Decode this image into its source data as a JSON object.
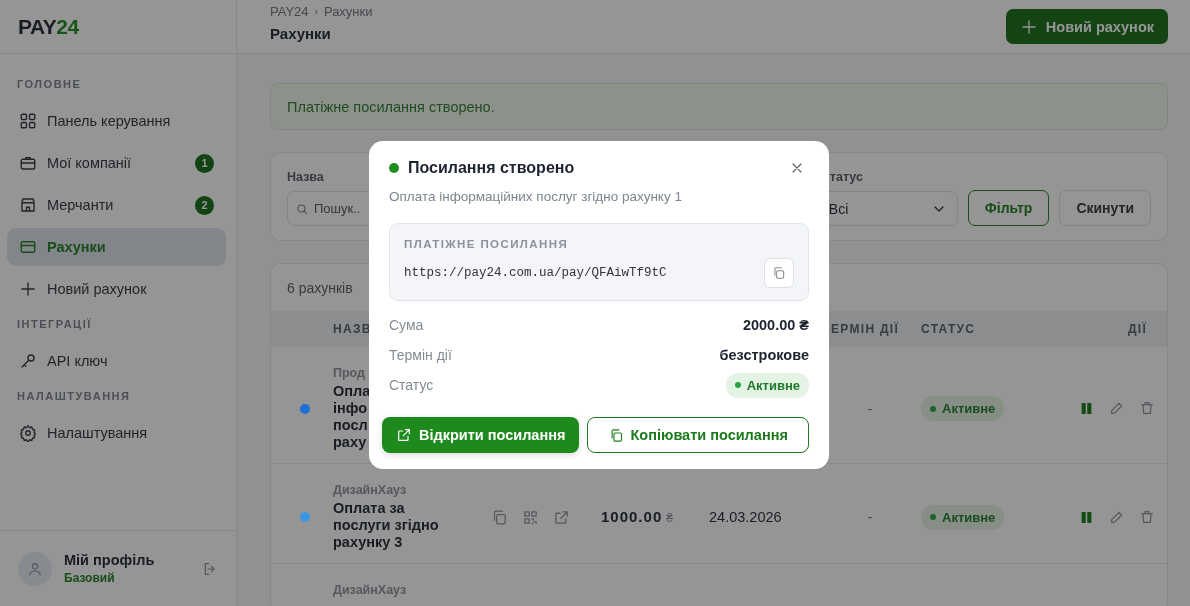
{
  "logo": {
    "text": "PAY",
    "accent": "24"
  },
  "sidebar": {
    "sections": [
      {
        "title": "ГОЛОВНЕ",
        "items": [
          {
            "label": "Панель керування",
            "selected": false
          },
          {
            "label": "Мої компанії",
            "badge": "1",
            "selected": false
          },
          {
            "label": "Мерчанти",
            "badge": "2",
            "selected": false
          },
          {
            "label": "Рахунки",
            "selected": true
          },
          {
            "label": "Новий рахунок",
            "selected": false
          }
        ]
      },
      {
        "title": "ІНТЕГРАЦІЇ",
        "items": [
          {
            "label": "API ключ",
            "selected": false
          }
        ]
      },
      {
        "title": "НАЛАШТУВАННЯ",
        "items": [
          {
            "label": "Налаштування",
            "selected": false
          }
        ]
      }
    ],
    "profile": {
      "name": "Мій профіль",
      "plan": "Базовий"
    }
  },
  "header": {
    "breadcrumb": [
      "PAY24",
      "Рахунки"
    ],
    "separator": "›",
    "title": "Рахунки",
    "new_button": "Новий рахунок"
  },
  "alert": "Платіжне посилання створено.",
  "filters": {
    "name_label": "Назва",
    "search_placeholder": "Пошук..",
    "status_label": "татус",
    "status_value": "Всі",
    "filter_button": "Фільтр",
    "reset_button": "Скинути"
  },
  "table": {
    "count": "6 рахунків",
    "headers": {
      "name": "НАЗВ",
      "term": "ЕРМІН ДІЇ",
      "status": "СТАТУС",
      "actions": "ДІЇ"
    },
    "rows": [
      {
        "color": "#1f6fd6",
        "company": "Прод",
        "title_lines": [
          "Опла",
          "інфо",
          "посл",
          "раху"
        ],
        "term": "-",
        "status": "Активне"
      },
      {
        "color": "#3b97e3",
        "company": "ДизайнХауз",
        "title_lines": [
          "Оплата за",
          "послуги згідно",
          "рахунку 3"
        ],
        "amount": "1000.00",
        "currency": "₴",
        "date": "24.03.2026",
        "term": "-",
        "status": "Активне"
      },
      {
        "company": "ДизайнХауз"
      }
    ]
  },
  "modal": {
    "title": "Посилання створено",
    "subtitle": "Оплата інформаційних послуг згідно рахунку 1",
    "link_label": "ПЛАТІЖНЕ ПОСИЛАННЯ",
    "url": "https://pay24.com.ua/pay/QFAiwTf9tC",
    "details": [
      {
        "label": "Сума",
        "value": "2000.00 ₴"
      },
      {
        "label": "Термін дії",
        "value": "безстрокове"
      },
      {
        "label": "Статус",
        "value": "Активне",
        "kind": "badge"
      }
    ],
    "open_button": "Відкрити посилання",
    "copy_button": "Копіювати посилання"
  }
}
